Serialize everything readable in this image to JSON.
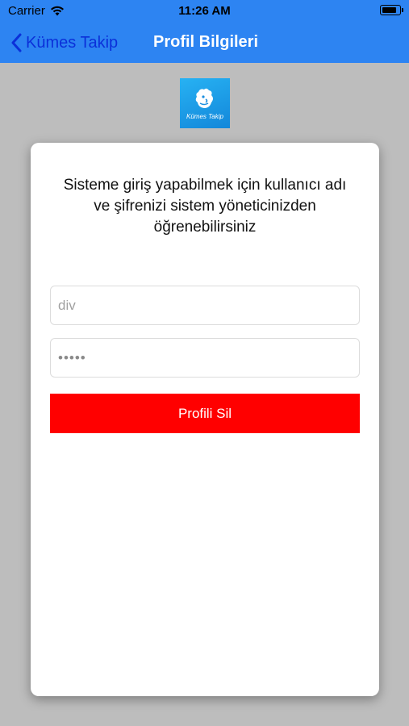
{
  "status_bar": {
    "carrier": "Carrier",
    "time": "11:26 AM"
  },
  "nav": {
    "back_label": "Kümes Takip",
    "title": "Profil Bilgileri"
  },
  "logo": {
    "text": "Kümes Takip"
  },
  "card": {
    "info": "Sisteme giriş yapabilmek için kullanıcı adı ve şifrenizi sistem yöneticinizden öğrenebilirsiniz",
    "username_placeholder": "div",
    "password_value": "•••••",
    "delete_label": "Profili Sil"
  },
  "colors": {
    "nav_bg": "#2d84f2",
    "back_link": "#0b30d9",
    "page_bg": "#bdbdbd",
    "delete_button": "#ff0000"
  }
}
